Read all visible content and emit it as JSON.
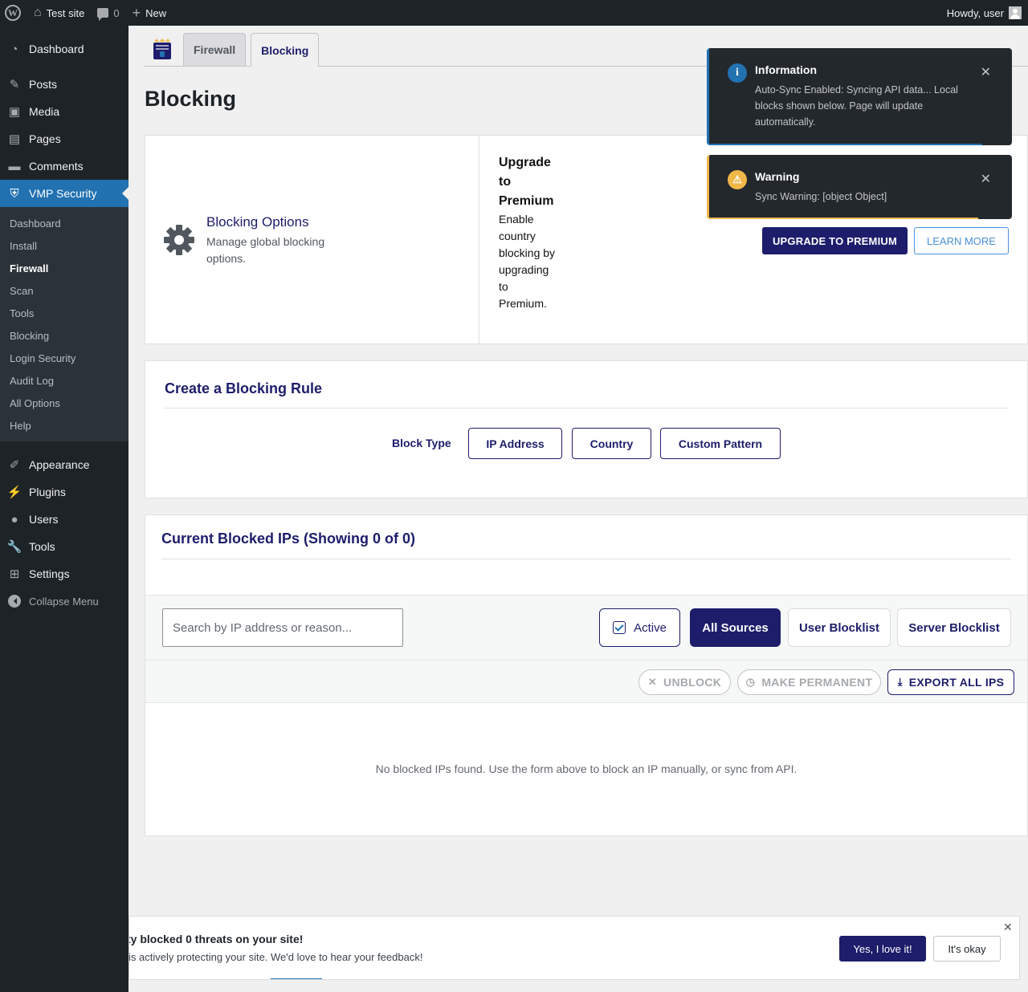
{
  "adminbar": {
    "site_name": "Test site",
    "comments_count": "0",
    "new_label": "New",
    "greeting": "Howdy, user"
  },
  "sidebar": {
    "items_top": [
      {
        "label": "Dashboard",
        "icon": "dashboard-icon"
      },
      {
        "label": "Posts",
        "icon": "pin-icon"
      },
      {
        "label": "Media",
        "icon": "media-icon"
      },
      {
        "label": "Pages",
        "icon": "pages-icon"
      },
      {
        "label": "Comments",
        "icon": "comments-icon"
      },
      {
        "label": "VMP Security",
        "icon": "shield-logo-icon"
      }
    ],
    "submenu": [
      "Dashboard",
      "Install",
      "Firewall",
      "Scan",
      "Tools",
      "Blocking",
      "Login Security",
      "Audit Log",
      "All Options",
      "Help"
    ],
    "current_submenu": "Firewall",
    "items_bottom": [
      {
        "label": "Appearance",
        "icon": "brush-icon"
      },
      {
        "label": "Plugins",
        "icon": "plug-icon"
      },
      {
        "label": "Users",
        "icon": "user-icon"
      },
      {
        "label": "Tools",
        "icon": "wrench-icon"
      },
      {
        "label": "Settings",
        "icon": "settings-icon"
      }
    ],
    "collapse_label": "Collapse Menu"
  },
  "tabs": [
    "Firewall",
    "Blocking"
  ],
  "active_tab": "Blocking",
  "page_title": "Blocking",
  "blocking_options": {
    "title": "Blocking Options",
    "description": "Manage global blocking options."
  },
  "upgrade": {
    "title": "Upgrade to Premium",
    "description": "Enable country blocking by upgrading to Premium.",
    "upgrade_button": "UPGRADE TO PREMIUM",
    "learn_button": "LEARN MORE"
  },
  "create_rule": {
    "title": "Create a Blocking Rule",
    "block_type_label": "Block Type",
    "types": [
      "IP Address",
      "Country",
      "Custom Pattern"
    ]
  },
  "blocked_ips": {
    "title": "Current Blocked IPs (Showing 0 of 0)",
    "search_placeholder": "Search by IP address or reason...",
    "active_label": "Active",
    "sources": [
      "All Sources",
      "User Blocklist",
      "Server Blocklist"
    ],
    "selected_source": "All Sources",
    "unblock_label": "UNBLOCK",
    "permanent_label": "MAKE PERMANENT",
    "export_label": "EXPORT ALL IPS",
    "empty_message": "No blocked IPs found. Use the form above to block an IP manually, or sync from API."
  },
  "toasts": {
    "info": {
      "title": "Information",
      "message": "Auto-Sync Enabled: Syncing API data... Local blocks shown below. Page will update automatically.",
      "color": "#2271b1"
    },
    "warning": {
      "title": "Warning",
      "message": "Sync Warning: [object Object]",
      "color": "#f0b849"
    }
  },
  "feedback": {
    "title": "ty blocked 0 threats on your site!",
    "message": "is actively protecting your site. We'd love to hear your feedback!",
    "yes_label": "Yes, I love it!",
    "ok_label": "It's okay"
  },
  "colors": {
    "brand_navy": "#1d1d6b",
    "wp_blue": "#2271b1",
    "admin_dark": "#1d2327"
  }
}
